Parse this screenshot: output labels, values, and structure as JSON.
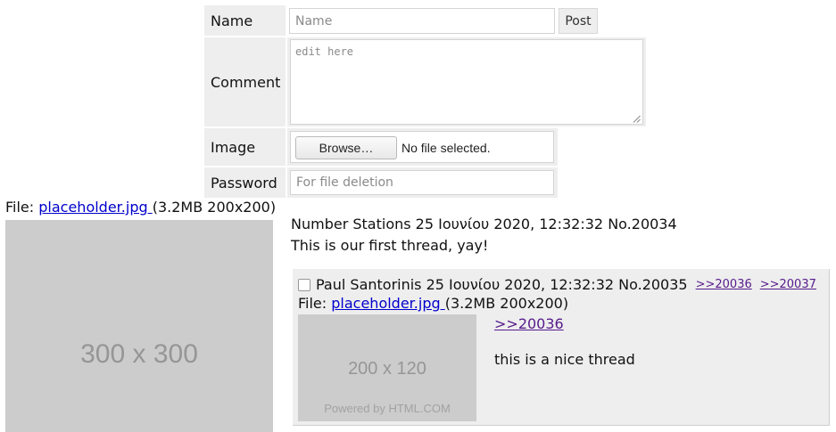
{
  "form": {
    "name_label": "Name",
    "name_placeholder": "Name",
    "post_label": "Post",
    "comment_label": "Comment",
    "comment_placeholder": "edit here",
    "image_label": "Image",
    "browse_label": "Browse…",
    "no_file_label": "No file selected.",
    "password_label": "Password",
    "password_placeholder": "For file deletion"
  },
  "op": {
    "file_prefix": "File: ",
    "file_name": "placeholder.jpg ",
    "file_meta": "(3.2MB 200x200)",
    "thumb_label": "300 x 300",
    "header": "Number Stations 25 Ιουνίου 2020, 12:32:32 No.20034",
    "body": "This is our first thread, yay!"
  },
  "reply": {
    "header": "Paul Santorinis 25 Ιουνίου 2020, 12:32:32 No.20035",
    "backlinks": [
      ">>20036",
      ">>20037"
    ],
    "file_prefix": "File: ",
    "file_name": "placeholder.jpg ",
    "file_meta": "(3.2MB 200x200)",
    "thumb_label": "200 x 120",
    "thumb_credit": "Powered by HTML.COM",
    "quote": ">>20036",
    "body": "this is a nice thread"
  },
  "colors": {
    "cell_bg": "#eeeeee",
    "link": "#0000cc",
    "visited_link": "#551a8b",
    "placeholder_bg": "#cccccc"
  }
}
